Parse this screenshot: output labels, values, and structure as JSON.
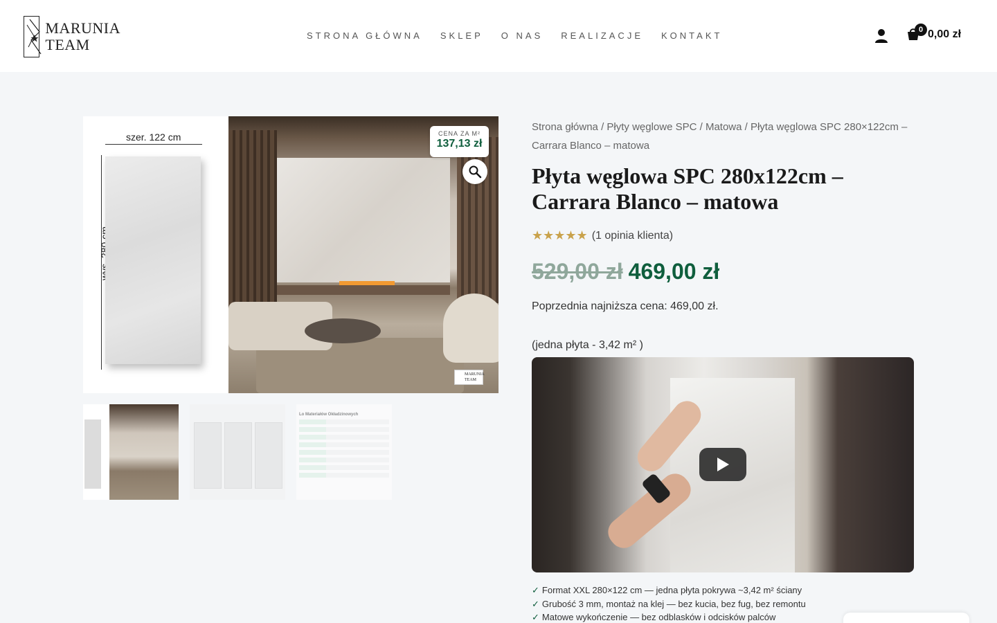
{
  "header": {
    "logo_line1": "MARUNIA",
    "logo_line2": "TEAM",
    "nav": [
      "STRONA GŁÓWNA",
      "SKLEP",
      "O NAS",
      "REALIZACJE",
      "KONTAKT"
    ],
    "cart_count": "0",
    "cart_total": "0,00 zł"
  },
  "gallery": {
    "width_label": "szer. 122 cm",
    "height_label": "wys. 280 cm",
    "badge_label": "CENA ZA M²",
    "badge_value": "137,13 zł",
    "watermark_line1": "MARUNIA",
    "watermark_line2": "TEAM",
    "thumb3_title": "Lo Materiałów Okładzinowych"
  },
  "product": {
    "breadcrumb": "Strona główna / Płyty węglowe SPC / Matowa / Płyta węglowa SPC 280×122cm – Carrara Blanco – matowa",
    "title": "Płyta węglowa SPC 280x122cm – Carrara Blanco – matowa",
    "rating_value": 5,
    "reviews": "(1 opinia klienta)",
    "old_price": "529,00 zł",
    "new_price": "469,00 zł",
    "lowest_price": "Poprzednia najniższa cena: 469,00 zł.",
    "plate_area": "(jedna płyta - 3,42 m² )",
    "features": [
      "Format XXL 280×122 cm — jedna płyta pokrywa ~3,42 m² ściany",
      "Grubość 3 mm, montaż na klej — bez kucia, bez fug, bez remontu",
      "Matowe wykończenie — bez odblasków i odcisków palców"
    ]
  },
  "colors": {
    "accent_green": "#0f5e3d",
    "star_gold": "#c9a24b",
    "old_price": "#8fa79b"
  }
}
